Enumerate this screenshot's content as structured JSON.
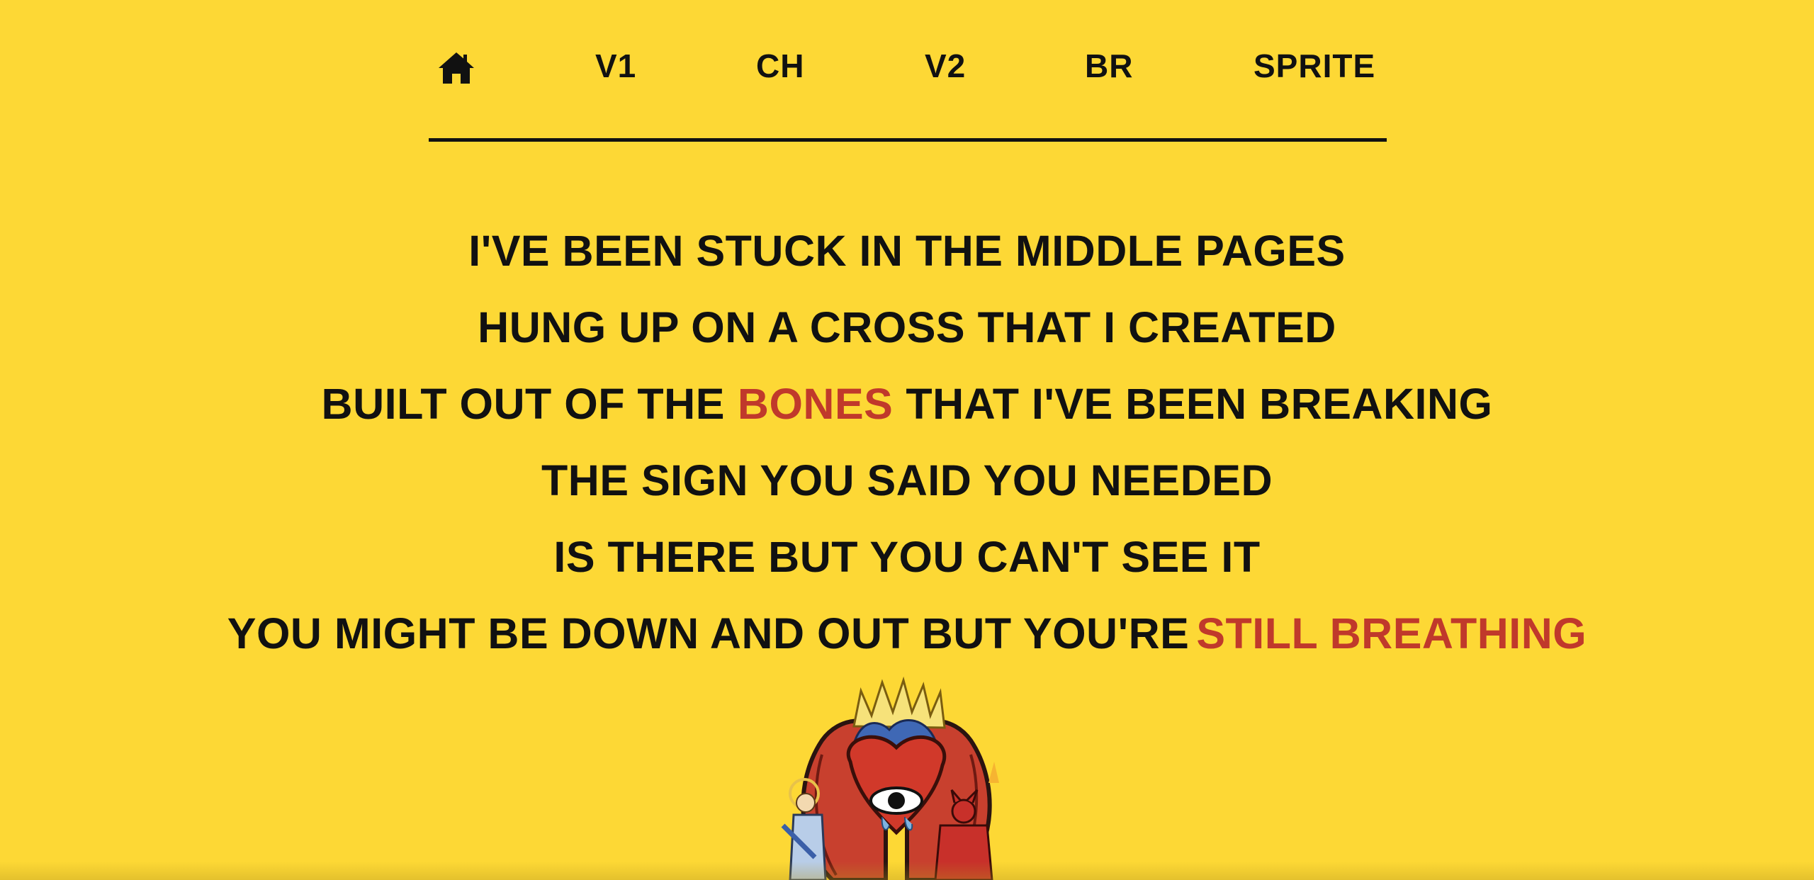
{
  "nav": {
    "home_icon": "home-icon",
    "items": [
      "V1",
      "CH",
      "V2",
      "BR",
      "SPRITE"
    ]
  },
  "lyrics": {
    "line1": "I'VE BEEN STUCK IN THE MIDDLE PAGES",
    "line2": "HUNG UP ON A CROSS THAT I CREATED",
    "line3_pre": "BUILT OUT OF THE",
    "line3_hl": "BONES",
    "line3_post": "THAT I'VE BEEN BREAKING",
    "line4": "THE SIGN YOU SAID YOU NEEDED",
    "line5": "IS THERE BUT YOU CAN'T SEE IT",
    "line6_pre": "YOU MIGHT BE DOWN AND OUT BUT YOU'RE",
    "line6_hl": "STILL BREATHING"
  },
  "colors": {
    "background": "#fdd835",
    "text": "#111111",
    "highlight": "#c0392b"
  },
  "artwork": "album-art-illustration"
}
